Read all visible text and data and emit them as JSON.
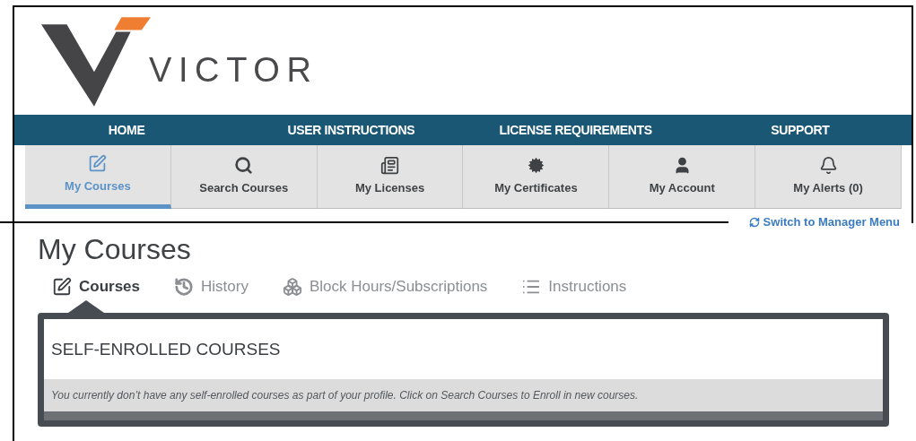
{
  "brand": {
    "name": "VICTOR"
  },
  "nav": [
    "HOME",
    "USER INSTRUCTIONS",
    "LICENSE REQUIREMENTS",
    "SUPPORT"
  ],
  "menu": [
    {
      "label": "My Courses",
      "kind": "edit",
      "selected": true
    },
    {
      "label": "Search Courses",
      "kind": "search",
      "selected": false
    },
    {
      "label": "My Licenses",
      "kind": "license",
      "selected": false
    },
    {
      "label": "My Certificates",
      "kind": "seal",
      "selected": false
    },
    {
      "label": "My Account",
      "kind": "user",
      "selected": false
    },
    {
      "label": "My Alerts (0)",
      "kind": "bell",
      "selected": false
    }
  ],
  "switch_link": "Switch to Manager Menu",
  "page_title": "My Courses",
  "subtabs": [
    {
      "label": "Courses",
      "kind": "edit",
      "selected": true
    },
    {
      "label": "History",
      "kind": "history",
      "selected": false
    },
    {
      "label": "Block Hours/Subscriptions",
      "kind": "cubes",
      "selected": false
    },
    {
      "label": "Instructions",
      "kind": "list",
      "selected": false
    }
  ],
  "panel": {
    "title": "SELF-ENROLLED COURSES",
    "message": "You currently don’t have any self-enrolled courses as part of your profile. Click on Search Courses to Enroll in new courses."
  }
}
